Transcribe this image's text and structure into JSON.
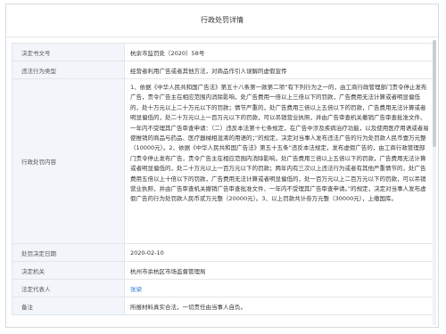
{
  "dialog": {
    "title": "行政处罚详情"
  },
  "rows": [
    {
      "label": "决定书文号",
      "value": "杭余市监罚处〔2020〕58号"
    },
    {
      "label": "违法行为类型",
      "value": "经营者利用广告或者其他方法，对商品作引人误解的虚假宣传"
    },
    {
      "label": "行政处罚内容",
      "value": "1、依据《中华人民共和国广告法》第五十八条第一款第二项“有下列行为之一的，由工商行政管理部门责令停止发布广告，责令广告主在相应范围内消除影响，处广告费用一倍以上三倍以下的罚款，广告费用无法计算或者明显偏低的，处十万元以上二十万元以下的罚款；情节严重的，处广告费用三倍以上五倍以下的罚款，广告费用无法计算或者明显偏低的，处二十万元以上一百万元以下的罚款，可以吊销营业执照，并由广告审查机关撤销广告审查批准文件、一年内不受理其广告审查申请：（二）违反本法第十七条规定，在广告中涉及疾病治疗功能，以及使用医疗用语或者易使推销的商品与药品、医疗器械相混淆的用语的；”的规定，决定对当事人发布违法广告的行为处罚款人民币壹万元整（10000元）。2、依据《中华人民共和国广告法》第五十五条“违反本法规定，发布虚假广告的，由工商行政管理部门责令停止发布广告，责令广告主在相应范围内消除影响，处广告费用三倍以上五倍以下的罚款，广告费用无法计算或者明显偏低的，处二十万元以上一百万元以下的罚款；两年内有三次以上违法行为或者有其他严重情节的，处广告费用五倍以上十倍以下的罚款，广告费用无法计算或者明显偏低的，处一百万元以上二百万元以下的罚款，可以吊销营业执照，并由广告审查机关撤销广告审查批准文件、一年内不受理其广告审查申请。”的规定，决定对当事人发布虚假广告的行为处罚款人民币贰万元整（20000元）。3、以上罚款共计叁万元整（30000元），上缴国库。"
    },
    {
      "label": "处罚决定日期",
      "value": "2020-02-10"
    },
    {
      "label": "决定机关",
      "value": "杭州市余杭区市场监督管理局"
    },
    {
      "label": "法定代表人",
      "value": "张梁"
    },
    {
      "label": "备注",
      "value": "所报材料真实合法，一切责任由当事人自负。"
    }
  ]
}
